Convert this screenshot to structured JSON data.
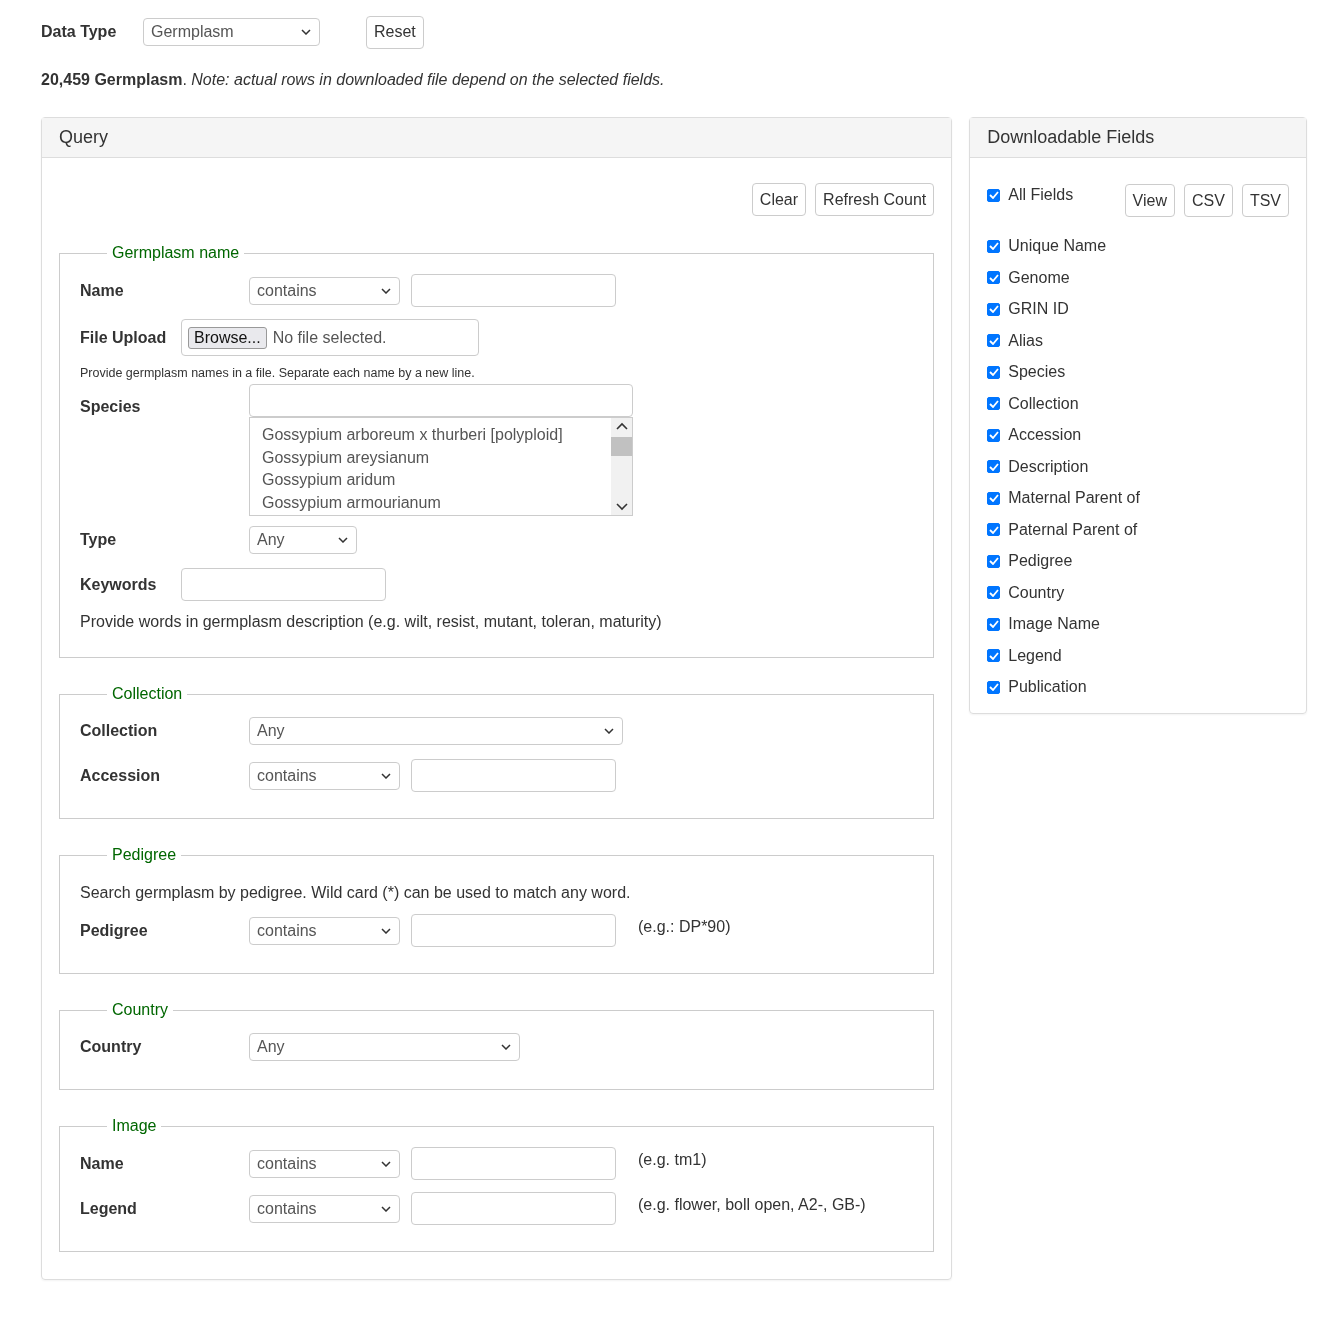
{
  "data_type": {
    "label": "Data Type",
    "value": "Germplasm",
    "reset": "Reset"
  },
  "summary": {
    "text": "**20,459 Germplasm**. *Note: actual rows in downloaded file depend on the selected fields.*"
  },
  "query": {
    "title": "Query",
    "buttons": [
      "Clear",
      "Refresh Count"
    ],
    "sections": [
      {
        "legend": "Germplasm name",
        "rows": [
          {
            "kind": "match",
            "label": "Name",
            "operator": "contains"
          },
          {
            "kind": "file",
            "label": "File Upload",
            "button": "Browse...",
            "status": "No file selected."
          },
          {
            "kind": "smallnote",
            "text": "Provide germplasm names in a file. Separate each name by a new line."
          },
          {
            "kind": "listbox",
            "label": "Species",
            "options": [
              "Gossypium arboreum x thurberi [polyploid]",
              "Gossypium areysianum",
              "Gossypium aridum",
              "Gossypium armourianum"
            ]
          },
          {
            "kind": "select",
            "label": "Type",
            "value": "Any"
          },
          {
            "kind": "text",
            "label": "Keywords"
          },
          {
            "kind": "note",
            "text": "Provide words in germplasm description (e.g. wilt, resist, mutant, toleran, maturity)"
          }
        ]
      },
      {
        "legend": "Collection",
        "rows": [
          {
            "kind": "select",
            "label": "Collection",
            "value": "Any"
          },
          {
            "kind": "match",
            "label": "Accession",
            "operator": "contains"
          }
        ]
      },
      {
        "legend": "Pedigree",
        "rows": [
          {
            "kind": "note",
            "text": "Search germplasm by pedigree. Wild card (*) can be used to match any word."
          },
          {
            "kind": "match",
            "label": "Pedigree",
            "operator": "contains",
            "hint": "(e.g.: DP*90)"
          }
        ]
      },
      {
        "legend": "Country",
        "rows": [
          {
            "kind": "select",
            "label": "Country",
            "value": "Any"
          }
        ]
      },
      {
        "legend": "Image",
        "rows": [
          {
            "kind": "match",
            "label": "Name",
            "operator": "contains",
            "hint": "(e.g. tm1)"
          },
          {
            "kind": "match",
            "label": "Legend",
            "operator": "contains",
            "hint": "(e.g. flower, boll open, A2-, GB-)"
          }
        ]
      }
    ]
  },
  "fields": {
    "title": "Downloadable Fields",
    "all": {
      "label": "All Fields",
      "checked": true
    },
    "buttons": [
      "View",
      "CSV",
      "TSV"
    ],
    "items": [
      {
        "label": "Unique Name",
        "checked": true
      },
      {
        "label": "Genome",
        "checked": true
      },
      {
        "label": "GRIN ID",
        "checked": true
      },
      {
        "label": "Alias",
        "checked": true
      },
      {
        "label": "Species",
        "checked": true
      },
      {
        "label": "Collection",
        "checked": true
      },
      {
        "label": "Accession",
        "checked": true
      },
      {
        "label": "Description",
        "checked": true
      },
      {
        "label": "Maternal Parent of",
        "checked": true
      },
      {
        "label": "Paternal Parent of",
        "checked": true
      },
      {
        "label": "Pedigree",
        "checked": true
      },
      {
        "label": "Country",
        "checked": true
      },
      {
        "label": "Image Name",
        "checked": true
      },
      {
        "label": "Legend",
        "checked": true
      },
      {
        "label": "Publication",
        "checked": true
      }
    ]
  }
}
